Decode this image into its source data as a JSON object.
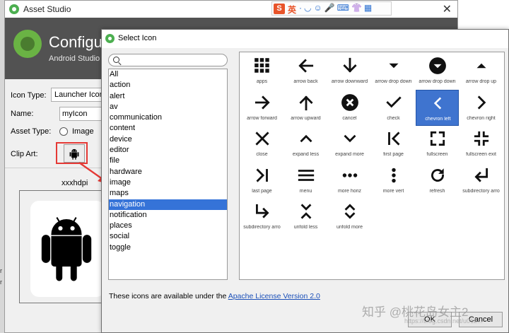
{
  "asset_studio": {
    "title": "Asset Studio",
    "header_title": "Configu",
    "header_subtitle": "Android Studio",
    "icon_type_label": "Icon Type:",
    "icon_type_value": "Launcher Icons",
    "name_label": "Name:",
    "name_value": "myIcon",
    "asset_type_label": "Asset Type:",
    "asset_type_option": "Image",
    "clip_art_label": "Clip Art:",
    "density_label": "xxxhdpi"
  },
  "ime_toolbar": {
    "logo": "S",
    "lang": "英",
    "icons": "·◡☺🎤⌨👚▦"
  },
  "left_edge": {
    "tick_a": "r",
    "tick_b": "r"
  },
  "dialog": {
    "title": "Select Icon",
    "search_placeholder": "",
    "categories": [
      "All",
      "action",
      "alert",
      "av",
      "communication",
      "content",
      "device",
      "editor",
      "file",
      "hardware",
      "image",
      "maps",
      "navigation",
      "notification",
      "places",
      "social",
      "toggle"
    ],
    "selected_category": "navigation",
    "icons": [
      {
        "name": "apps",
        "icon": "apps-icon"
      },
      {
        "name": "arrow back",
        "icon": "arrow-back-icon"
      },
      {
        "name": "arrow downward",
        "icon": "arrow-downward-icon"
      },
      {
        "name": "arrow drop down",
        "icon": "arrow-drop-down-icon"
      },
      {
        "name": "arrow drop down",
        "icon": "arrow-drop-down-circle-icon"
      },
      {
        "name": "arrow drop up",
        "icon": "arrow-drop-up-icon"
      },
      {
        "name": "arrow forward",
        "icon": "arrow-forward-icon"
      },
      {
        "name": "arrow upward",
        "icon": "arrow-upward-icon"
      },
      {
        "name": "cancel",
        "icon": "cancel-icon"
      },
      {
        "name": "check",
        "icon": "check-icon"
      },
      {
        "name": "chevron left",
        "icon": "chevron-left-icon",
        "selected": true
      },
      {
        "name": "chevron right",
        "icon": "chevron-right-icon"
      },
      {
        "name": "close",
        "icon": "close-icon"
      },
      {
        "name": "expand less",
        "icon": "expand-less-icon"
      },
      {
        "name": "expand more",
        "icon": "expand-more-icon"
      },
      {
        "name": "first page",
        "icon": "first-page-icon"
      },
      {
        "name": "fullscreen",
        "icon": "fullscreen-icon"
      },
      {
        "name": "fullscreen exit",
        "icon": "fullscreen-exit-icon"
      },
      {
        "name": "last page",
        "icon": "last-page-icon"
      },
      {
        "name": "menu",
        "icon": "menu-icon"
      },
      {
        "name": "more horiz",
        "icon": "more-horiz-icon"
      },
      {
        "name": "more vert",
        "icon": "more-vert-icon"
      },
      {
        "name": "refresh",
        "icon": "refresh-icon"
      },
      {
        "name": "subdirectory arro",
        "icon": "subdirectory-arrow-left-icon"
      },
      {
        "name": "subdirectory arro",
        "icon": "subdirectory-arrow-right-icon"
      },
      {
        "name": "unfold less",
        "icon": "unfold-less-icon"
      },
      {
        "name": "unfold more",
        "icon": "unfold-more-icon"
      }
    ],
    "license_text": "These icons are available under the ",
    "license_link": "Apache License Version 2.0",
    "ok_label": "OK",
    "cancel_label": "Cancel"
  },
  "watermark": {
    "text": "知乎 @桃花岛女主2",
    "sub": "https://blog.csdn.net/u012..."
  }
}
